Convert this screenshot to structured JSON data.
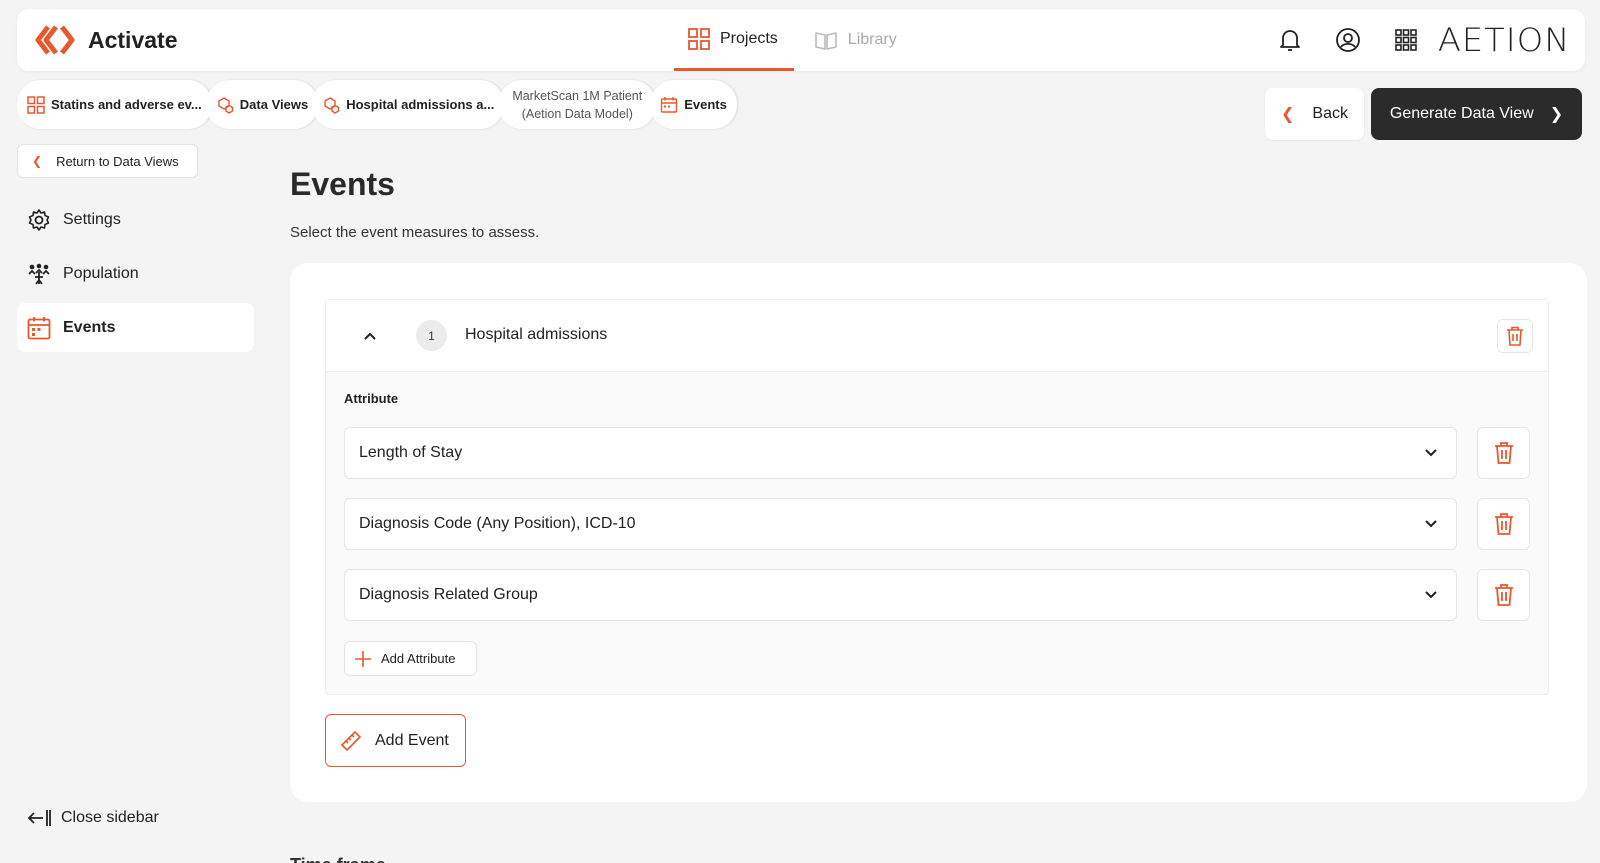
{
  "app": {
    "name": "Activate",
    "vendor": "AETION"
  },
  "nav": {
    "projects": "Projects",
    "library": "Library"
  },
  "breadcrumbs": [
    {
      "label": "Statins and adverse ev...",
      "icon": "grid-icon"
    },
    {
      "label": "Data Views",
      "icon": "cubes-icon"
    },
    {
      "label": "Hospital admissions a...",
      "icon": "cubes-icon"
    },
    {
      "line1": "MarketScan 1M Patient",
      "line2": "(Aetion Data Model)"
    },
    {
      "label": "Events",
      "icon": "calendar-icon"
    }
  ],
  "actions": {
    "back": "Back",
    "generate": "Generate Data View"
  },
  "sidebar": {
    "return": "Return to Data Views",
    "items": [
      {
        "label": "Settings",
        "icon": "gear-icon"
      },
      {
        "label": "Population",
        "icon": "people-icon"
      },
      {
        "label": "Events",
        "icon": "calendar-icon",
        "active": true
      }
    ],
    "close": "Close sidebar"
  },
  "page": {
    "title": "Events",
    "subtitle": "Select the event measures to assess."
  },
  "event": {
    "number": "1",
    "name": "Hospital admissions",
    "attribute_label": "Attribute",
    "attributes": [
      "Length of Stay",
      "Diagnosis Code (Any Position), ICD-10",
      "Diagnosis Related Group"
    ],
    "add_attribute": "Add Attribute"
  },
  "add_event": "Add Event",
  "next_section_peek": "Time frame",
  "colors": {
    "accent": "#e8582f",
    "dark": "#2b2b2b",
    "background": "#f4f4f4"
  }
}
